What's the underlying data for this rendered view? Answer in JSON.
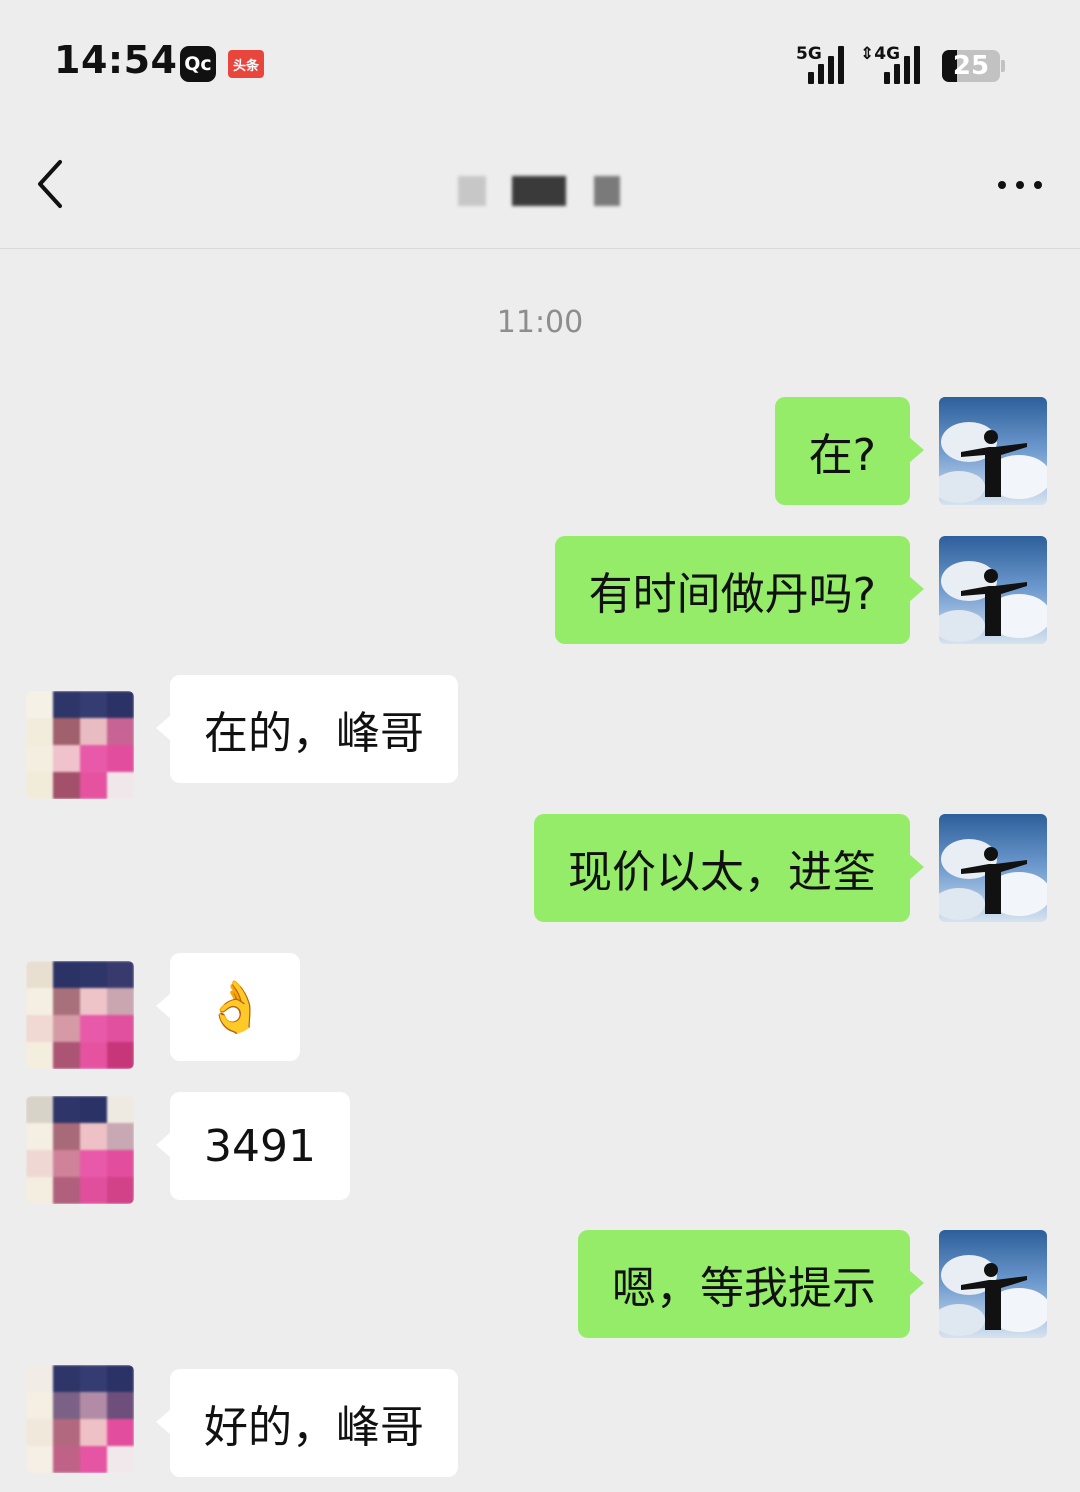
{
  "status_bar": {
    "time": "14:54",
    "app_icons": [
      "qc-app-icon",
      "toutiao-icon"
    ],
    "toutiao_label": "头条",
    "qc_label": "Qc",
    "signal1_label": "5G",
    "signal2_label": "⇕4G",
    "battery_level": "25"
  },
  "nav": {
    "back_icon": "chevron-left-icon",
    "more_icon": "more-dots-icon"
  },
  "chat": {
    "timestamp": "11:00",
    "messages": [
      {
        "from": "self",
        "text": "在?"
      },
      {
        "from": "self",
        "text": "有时间做丹吗?"
      },
      {
        "from": "other",
        "text": "在的，峰哥"
      },
      {
        "from": "self",
        "text": "现价以太，进筌"
      },
      {
        "from": "other",
        "text": "👌"
      },
      {
        "from": "other",
        "text": "3491"
      },
      {
        "from": "self",
        "text": "嗯，等我提示"
      },
      {
        "from": "other",
        "text": "好的，峰哥"
      }
    ]
  },
  "colors": {
    "background": "#ededed",
    "self_bubble": "#95ec69",
    "other_bubble": "#ffffff",
    "timestamp": "#8d8d8d"
  }
}
